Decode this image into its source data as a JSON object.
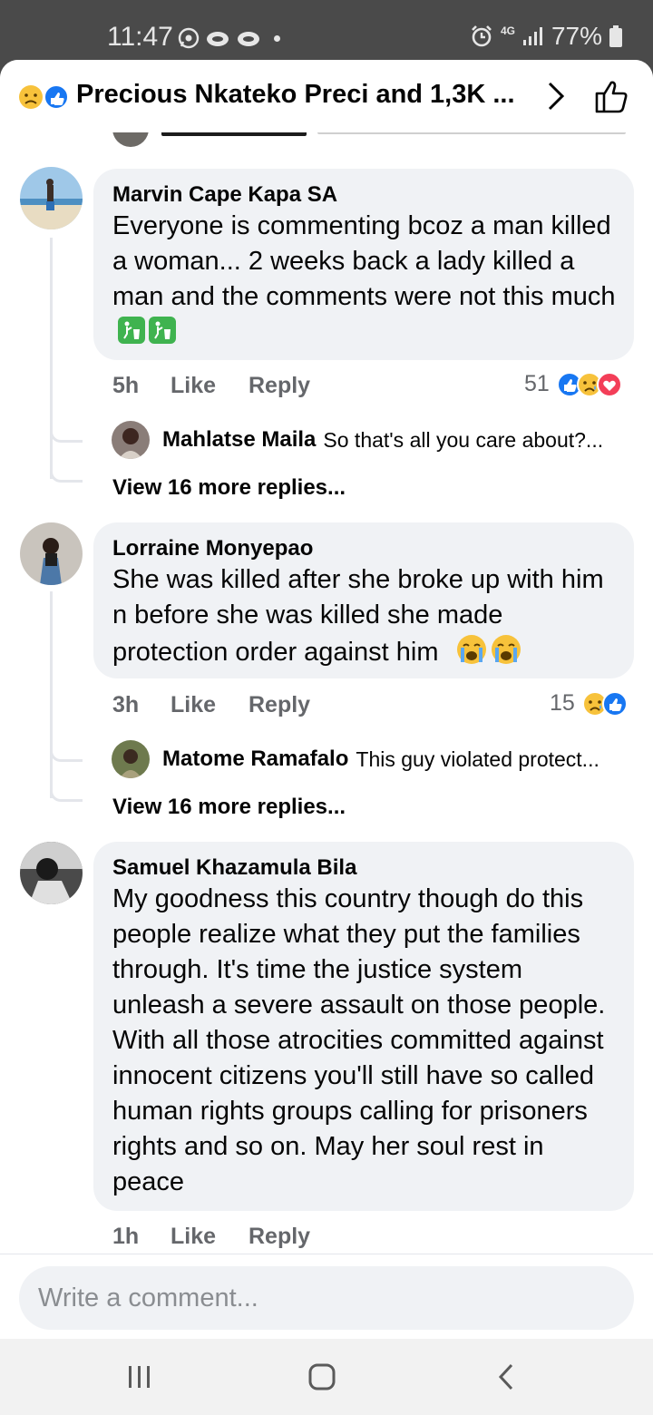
{
  "status_bar": {
    "time": "11:47",
    "network": "4G",
    "battery": "77%"
  },
  "header": {
    "title": "Precious Nkateko Preci and 1,3K ..."
  },
  "comments": [
    {
      "author": "Marvin Cape Kapa SA",
      "text": "Everyone is commenting bcoz a man killed a woman... 2 weeks back a lady killed a man and the comments were not this much",
      "emojis": [
        "litter-bin-icon",
        "litter-bin-icon"
      ],
      "time": "5h",
      "like_label": "Like",
      "reply_label": "Reply",
      "reaction_count": "51",
      "reactions": [
        "like-icon",
        "sad-icon",
        "love-icon"
      ],
      "reply": {
        "author": "Mahlatse Maila",
        "text": "So that's all you care about?..."
      },
      "view_more": "View 16 more replies..."
    },
    {
      "author": "Lorraine Monyepao",
      "text": "She was killed after she broke up with him n before she was killed she made protection order against him",
      "emojis": [
        "crying-face-icon",
        "crying-face-icon"
      ],
      "time": "3h",
      "like_label": "Like",
      "reply_label": "Reply",
      "reaction_count": "15",
      "reactions": [
        "sad-icon",
        "like-icon"
      ],
      "reply": {
        "author": "Matome Ramafalo",
        "text": "This guy violated protect..."
      },
      "view_more": "View 16 more replies..."
    },
    {
      "author": "Samuel Khazamula Bila",
      "text": "My goodness this country though do this people realize what they put the families through. It's time the justice system unleash a severe assault on those people. With all those atrocities committed against innocent citizens you'll still have so called human rights groups calling for prisoners rights and so on. May her soul rest in peace",
      "time": "1h",
      "like_label": "Like",
      "reply_label": "Reply"
    }
  ],
  "composer": {
    "placeholder": "Write a comment..."
  },
  "colors": {
    "like_blue": "#1877f2",
    "love_red": "#f33e58",
    "bubble": "#f0f2f5",
    "meta_gray": "#65676b"
  }
}
